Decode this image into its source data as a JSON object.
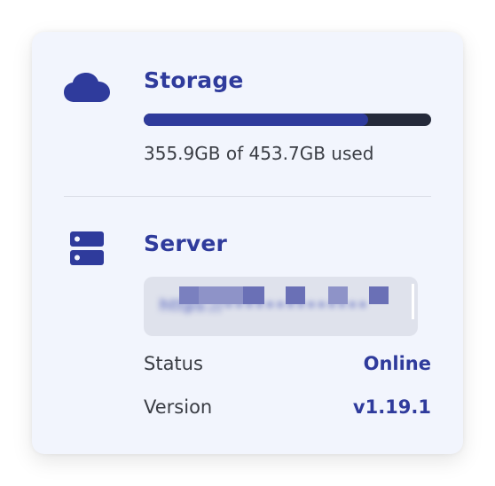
{
  "storage": {
    "title": "Storage",
    "usage_text": "355.9GB of 453.7GB used",
    "used_fraction": 0.78
  },
  "server": {
    "title": "Server",
    "url_text": "https://••••••••••••••",
    "status_label": "Status",
    "status_value": "Online",
    "version_label": "Version",
    "version_value": "v1.19.1"
  },
  "icons": {
    "storage": "cloud-icon",
    "server": "server-icon"
  },
  "colors": {
    "accent": "#2f3b9c",
    "track": "#252a3a",
    "card_bg": "#f2f5fd",
    "text": "#3a3d44"
  }
}
